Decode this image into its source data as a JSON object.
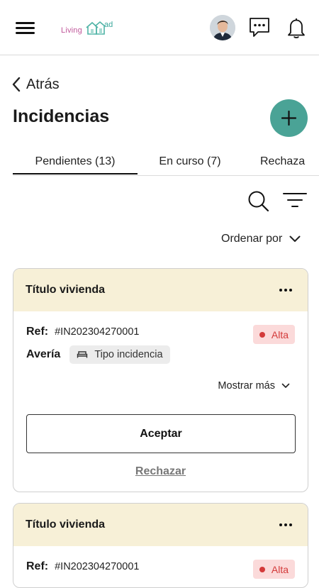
{
  "header": {
    "logo": {
      "part1": "Living",
      "part2": "ad"
    },
    "icons": {
      "menu": "hamburger-icon",
      "chat": "chat-icon",
      "notifications": "bell-icon"
    }
  },
  "nav": {
    "back_label": "Atrás"
  },
  "page": {
    "title": "Incidencias"
  },
  "tabs": [
    {
      "label": "Pendientes (13)",
      "active": true
    },
    {
      "label": "En curso (7)",
      "active": false
    },
    {
      "label": "Rechaza",
      "active": false
    }
  ],
  "sort": {
    "label": "Ordenar por"
  },
  "cards": [
    {
      "title": "Título vivienda",
      "ref_label": "Ref:",
      "ref_value": "#IN202304270001",
      "priority": "Alta",
      "type_label": "Avería",
      "category": "Tipo incidencia",
      "show_more": "Mostrar más",
      "accept_label": "Aceptar",
      "reject_label": "Rechazar"
    },
    {
      "title": "Título vivienda",
      "ref_label": "Ref:",
      "ref_value": "#IN202304270001",
      "priority": "Alta"
    }
  ],
  "colors": {
    "accent": "#4aa396",
    "card_header": "#f7f0d7",
    "priority_bg": "#fbdada",
    "priority_fg": "#d33a3a",
    "logo_pink": "#c0579a"
  }
}
